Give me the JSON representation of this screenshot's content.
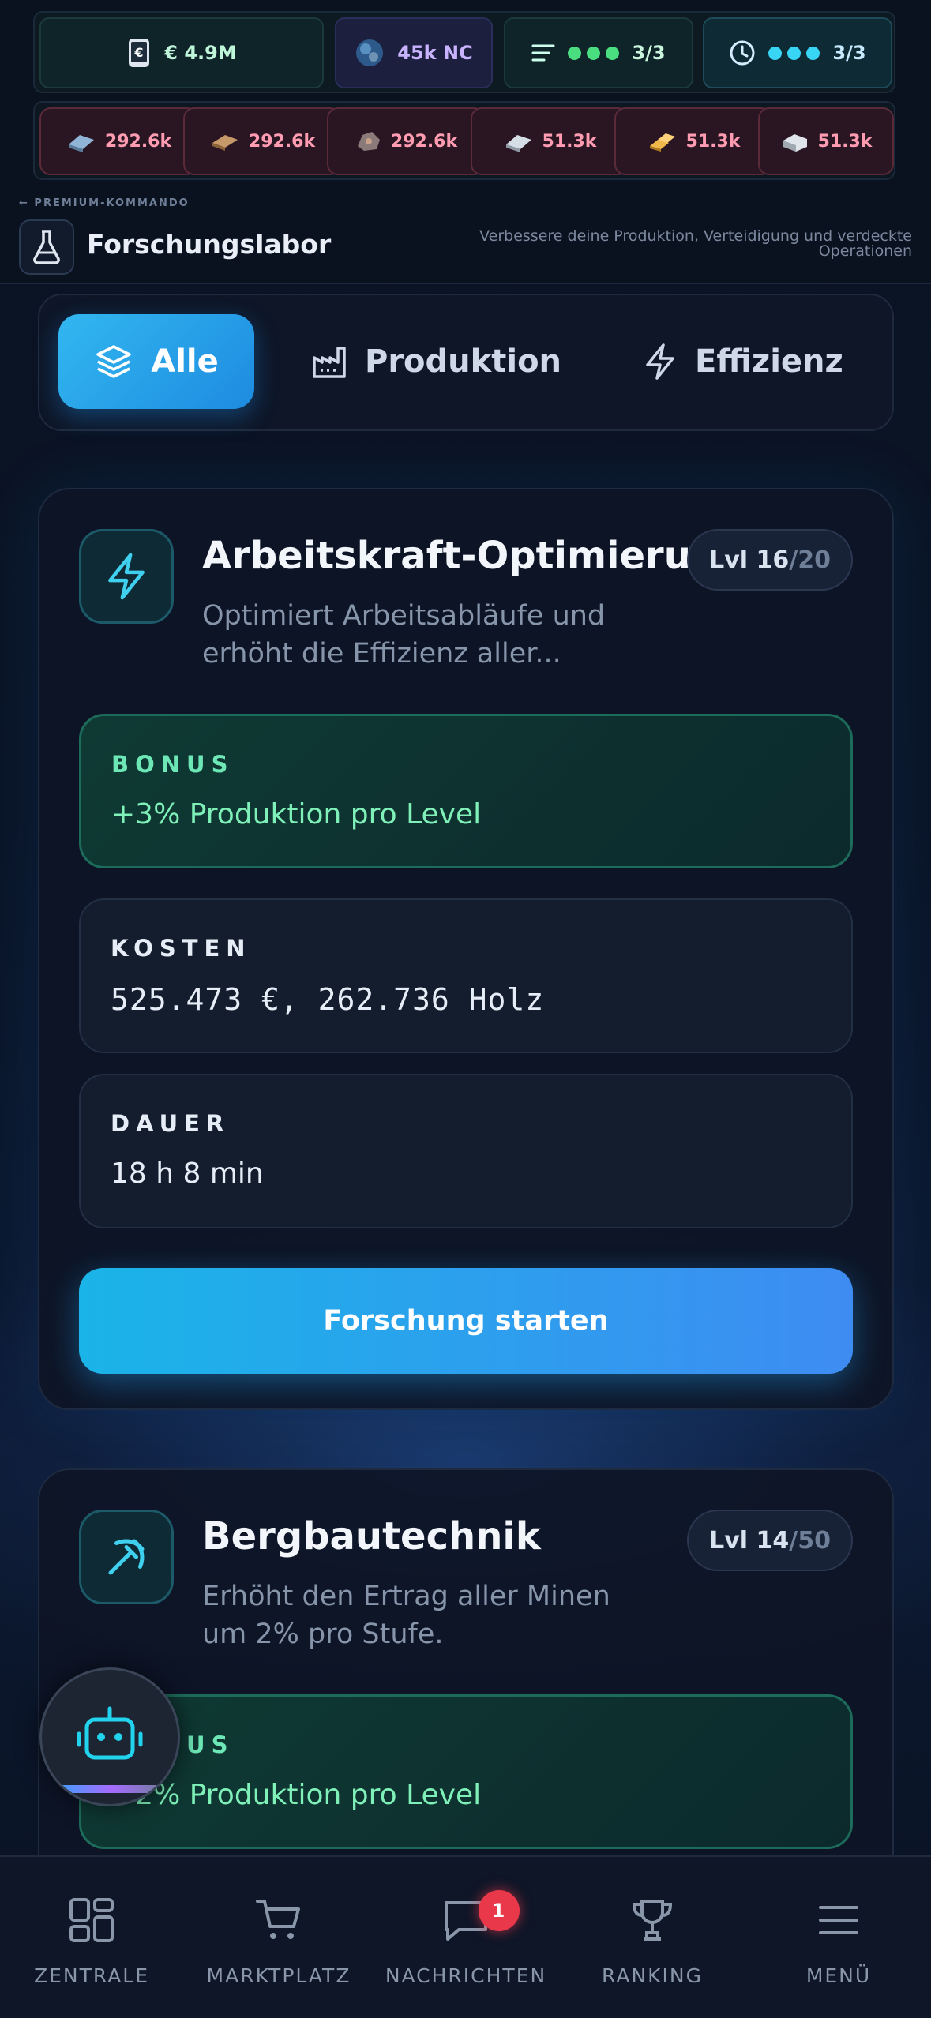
{
  "stats": {
    "money": "€ 4.9M",
    "nc": "45k NC",
    "queue_count": "3/3",
    "timer_count": "3/3"
  },
  "resources": [
    "292.6k",
    "292.6k",
    "292.6k",
    "51.3k",
    "51.3k",
    "51.3k"
  ],
  "header": {
    "breadcrumb": "← PREMIUM-KOMMANDO",
    "title": "Forschungslabor",
    "subtitle": "Verbessere deine Produktion, Verteidigung und verdeckte Operationen"
  },
  "tabs": [
    {
      "label": "Alle",
      "icon": "layers-icon"
    },
    {
      "label": "Produktion",
      "icon": "factory-icon"
    },
    {
      "label": "Effizienz",
      "icon": "lightning-icon"
    }
  ],
  "cards": [
    {
      "title": "Arbeitskraft-Optimierung",
      "description": "Optimiert Arbeitsabläufe und erhöht die Effizienz aller...",
      "level": "Lvl 16",
      "max": "/20",
      "bonus_label": "BONUS",
      "bonus_value": "+3% Produktion pro Level",
      "cost_label": "KOSTEN",
      "cost_value": "525.473 €, 262.736 Holz",
      "duration_label": "DAUER",
      "duration_value": "18 h 8 min",
      "button": "Forschung starten"
    },
    {
      "title": "Bergbautechnik",
      "description": "Erhöht den Ertrag aller Minen um 2% pro Stufe.",
      "level": "Lvl 14",
      "max": "/50",
      "bonus_label": "BONUS",
      "bonus_value": "+2% Produktion pro Level"
    }
  ],
  "nav": [
    {
      "label": "ZENTRALE",
      "icon": "grid-icon"
    },
    {
      "label": "MARKTPLATZ",
      "icon": "cart-icon"
    },
    {
      "label": "NACHRICHTEN",
      "icon": "chat-icon",
      "badge": "1"
    },
    {
      "label": "RANKING",
      "icon": "trophy-icon"
    },
    {
      "label": "MENÜ",
      "icon": "menu-icon"
    }
  ],
  "colors": {
    "accent": "#1ab4e8",
    "bonus_green": "#5fe0a8",
    "badge_red": "#e8384a"
  }
}
